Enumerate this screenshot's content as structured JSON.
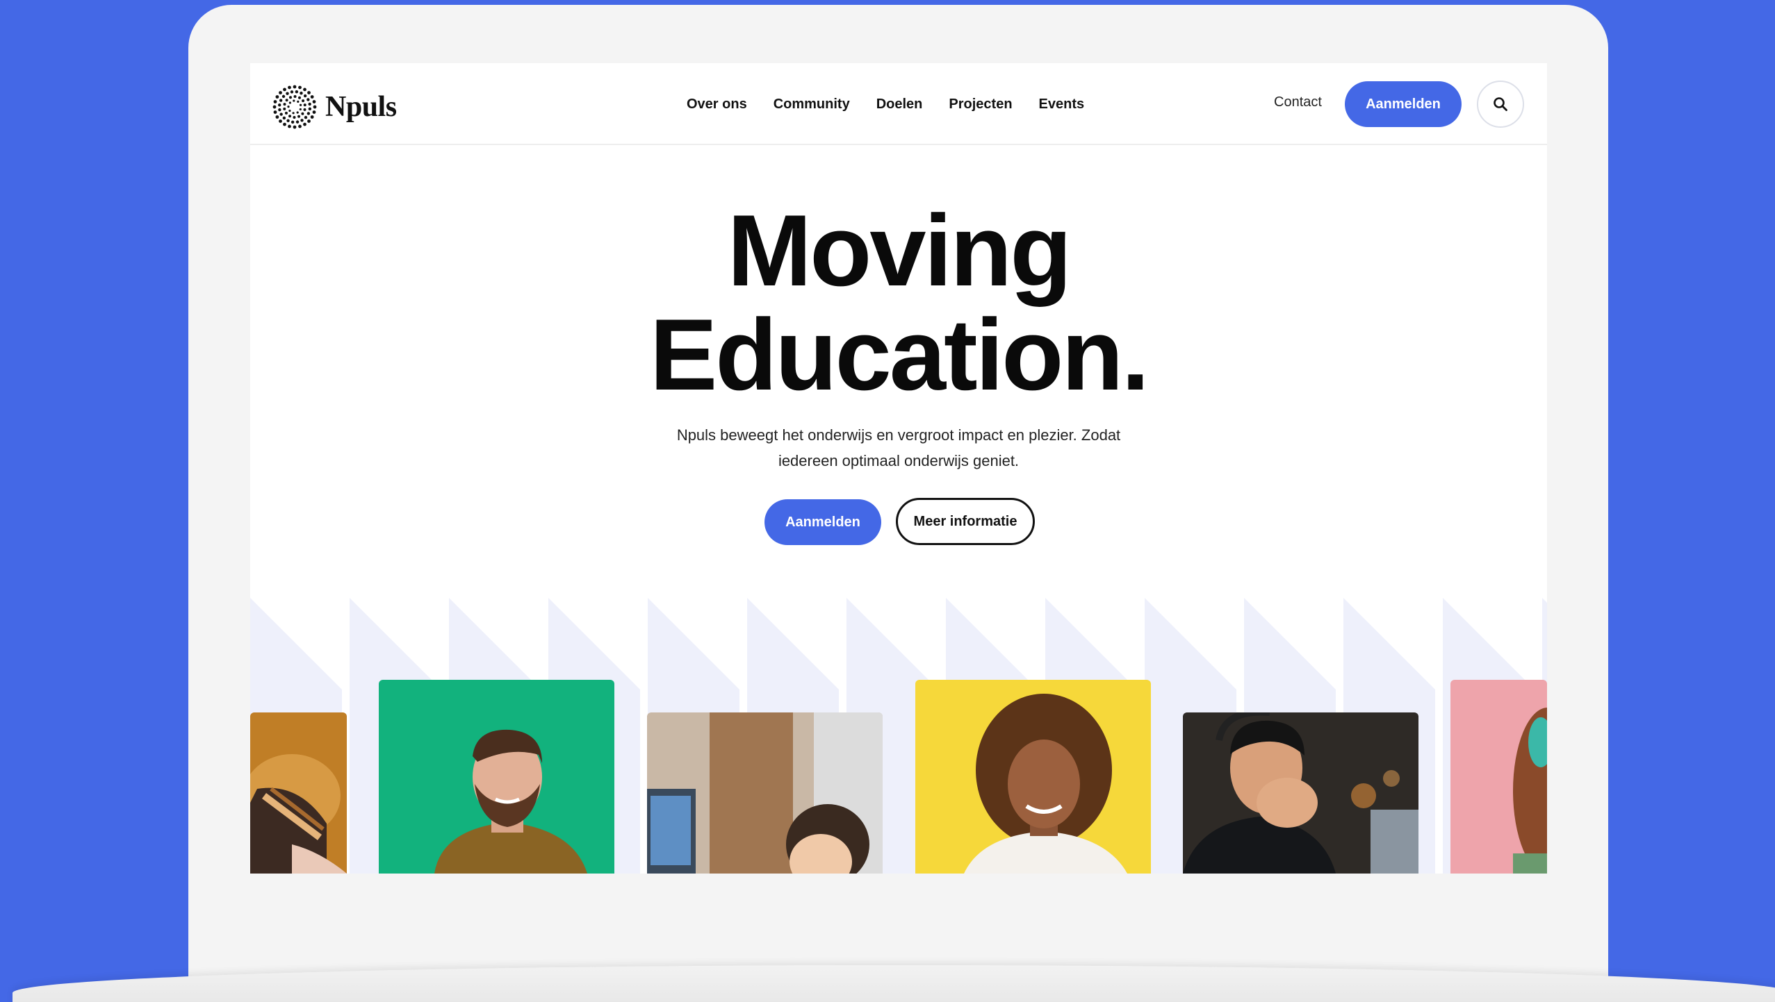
{
  "brand": {
    "name": "Npuls"
  },
  "nav": {
    "items": [
      {
        "label": "Over ons"
      },
      {
        "label": "Community"
      },
      {
        "label": "Doelen"
      },
      {
        "label": "Projecten"
      },
      {
        "label": "Events"
      }
    ],
    "contact_label": "Contact",
    "signup_label": "Aanmelden"
  },
  "hero": {
    "title_line1": "Moving",
    "title_line2": "Education.",
    "subtitle_line1": "Npuls beweegt het onderwijs en vergroot impact en plezier. Zodat",
    "subtitle_line2": "iedereen optimaal onderwijs geniet.",
    "primary_cta": "Aanmelden",
    "secondary_cta": "Meer informatie"
  },
  "icons": {
    "logo": "sunburst-dots-icon",
    "search": "search-icon"
  },
  "colors": {
    "background": "#4468e6",
    "accent": "#4468e6",
    "band": "#eef0fb",
    "card_green": "#12b27d",
    "card_yellow": "#f6d83a",
    "card_pink": "#eea4ab"
  }
}
